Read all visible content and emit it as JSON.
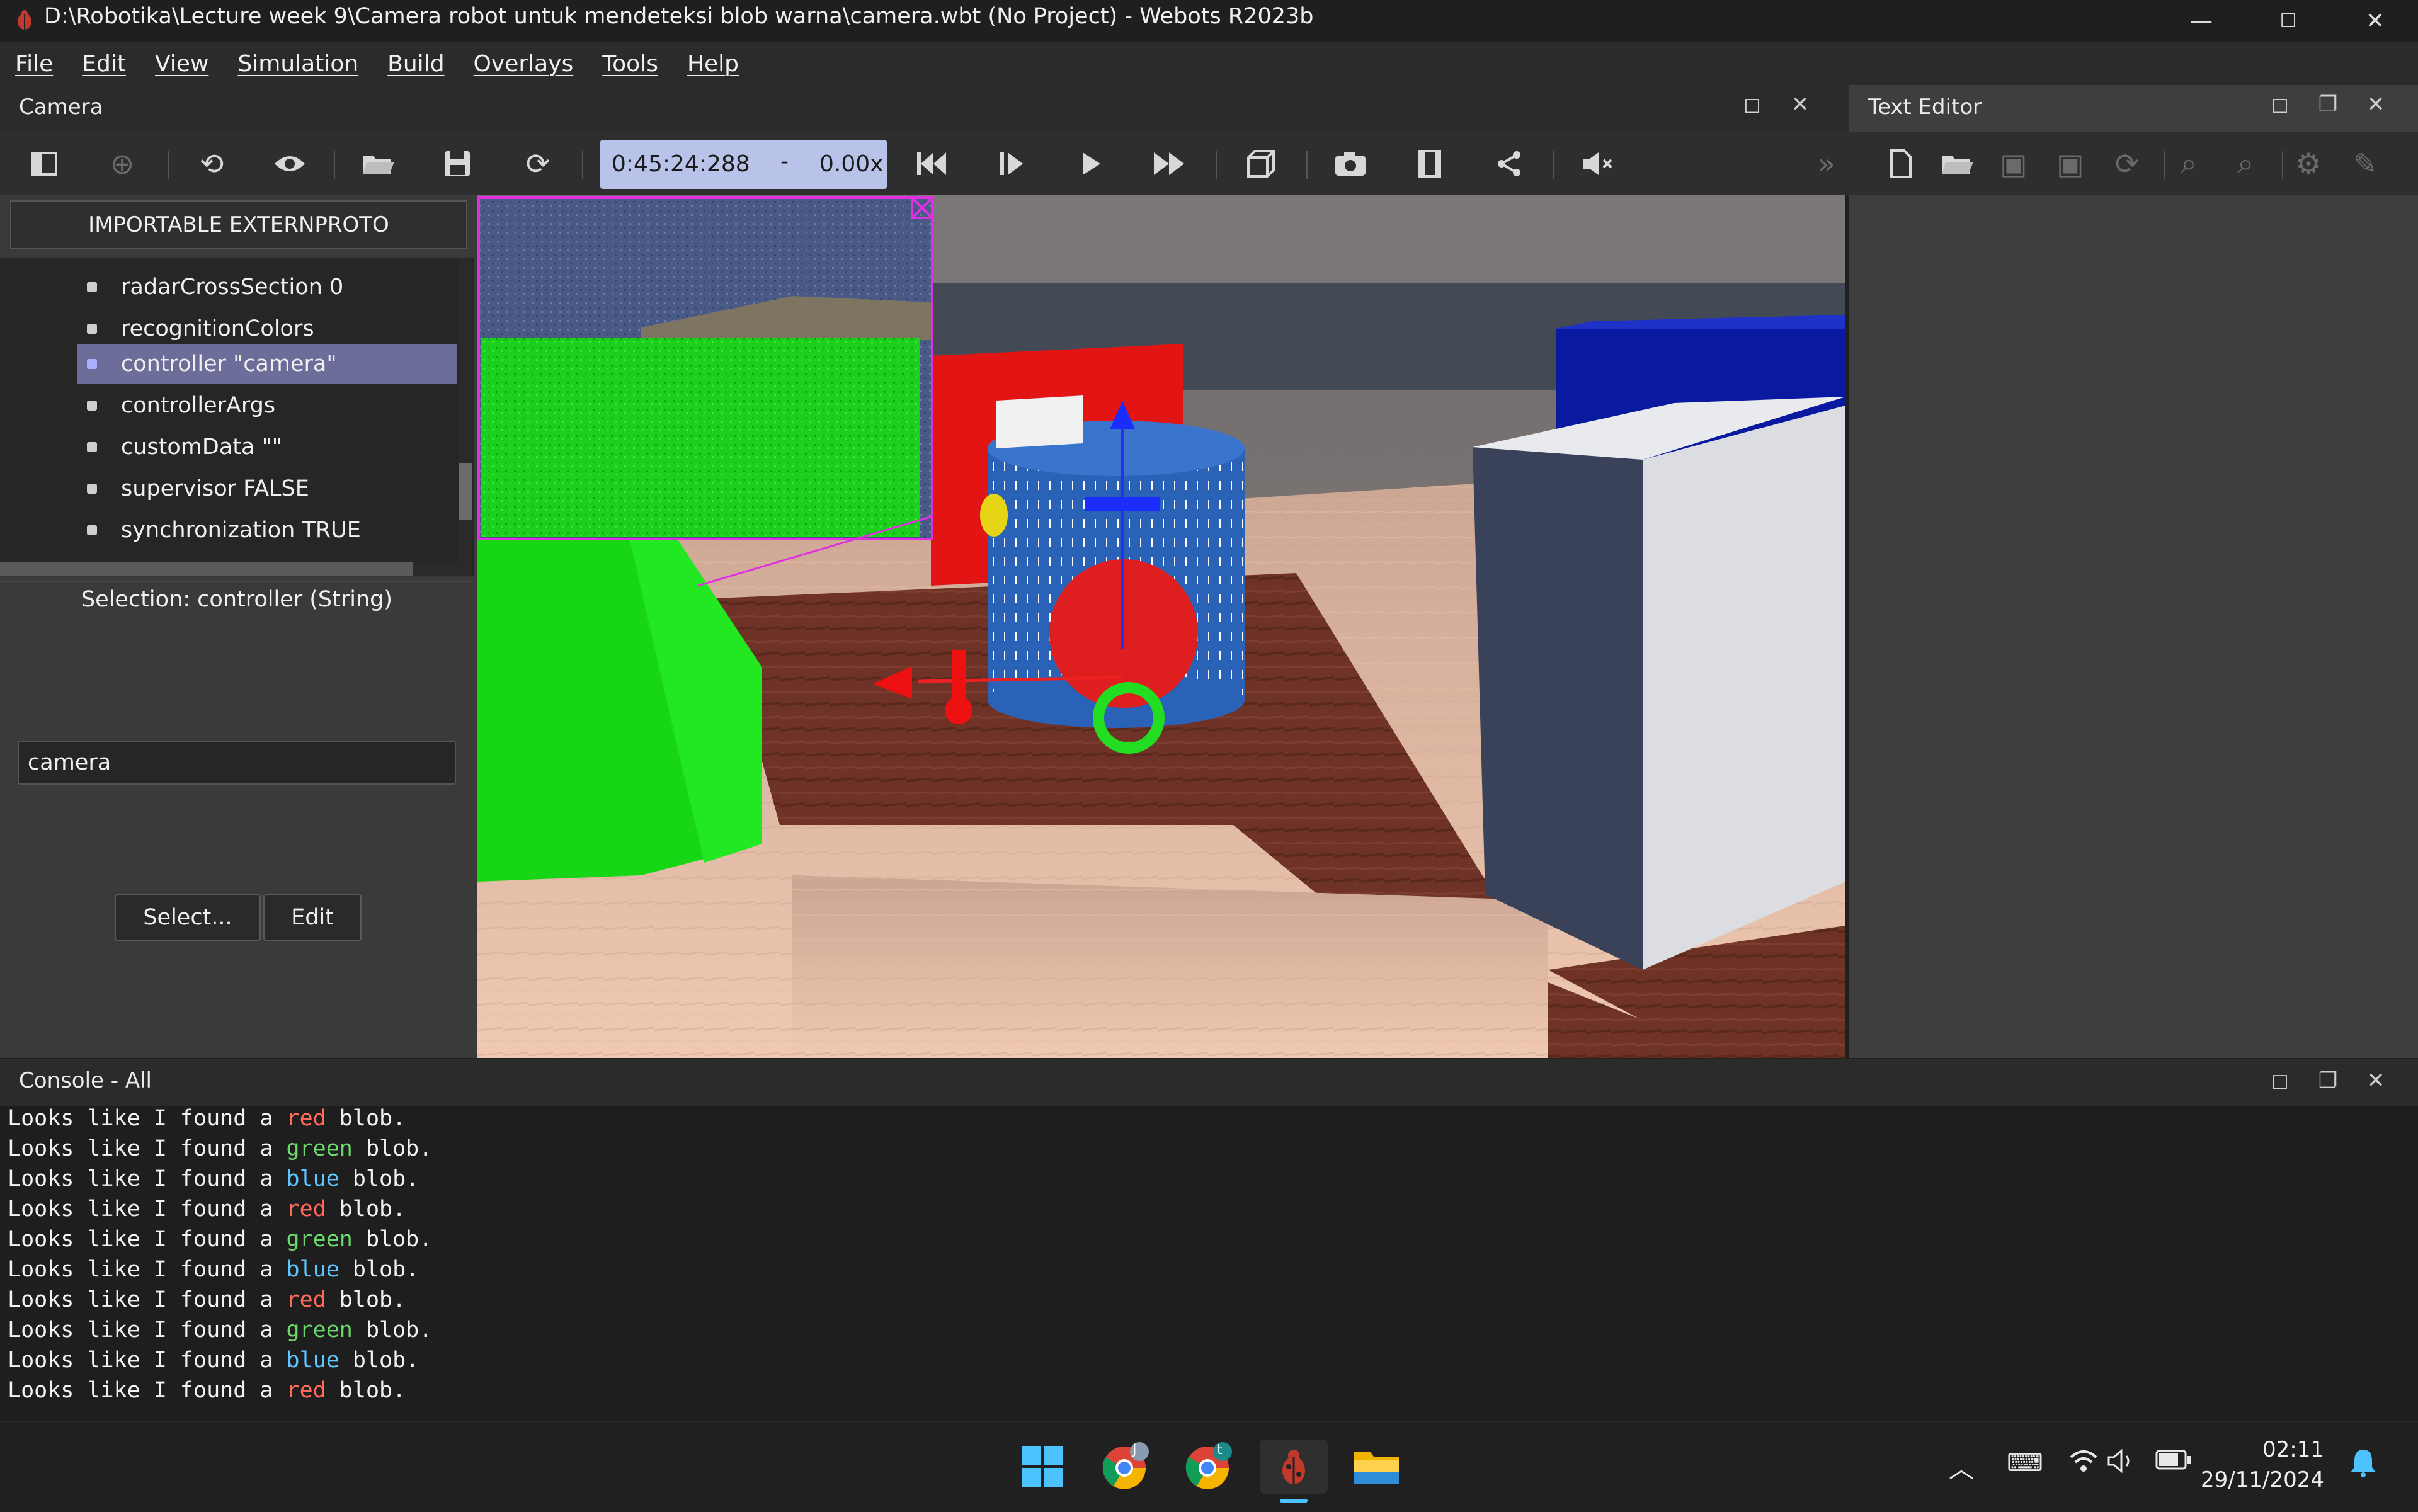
{
  "window": {
    "title": "D:\\Robotika\\Lecture week 9\\Camera robot untuk mendeteksi blob warna\\camera.wbt (No Project) - Webots R2023b",
    "minimize": "—",
    "maximize": "☐",
    "close": "✕"
  },
  "menu": [
    "File",
    "Edit",
    "View",
    "Simulation",
    "Build",
    "Overlays",
    "Tools",
    "Help"
  ],
  "camera_dock": {
    "title": "Camera"
  },
  "toolbar": {
    "time": "0:45:24:288",
    "dash": "-",
    "speed": "0.00x"
  },
  "scene_tree": {
    "importable_button": "IMPORTABLE EXTERNPROTO",
    "items": [
      {
        "label": "radarCrossSection 0",
        "selected": false
      },
      {
        "label": "recognitionColors",
        "selected": false
      },
      {
        "label": "controller \"camera\"",
        "selected": true
      },
      {
        "label": "controllerArgs",
        "selected": false
      },
      {
        "label": "customData \"\"",
        "selected": false
      },
      {
        "label": "supervisor FALSE",
        "selected": false
      },
      {
        "label": "synchronization TRUE",
        "selected": false
      }
    ]
  },
  "field_editor": {
    "selection": "Selection: controller (String)",
    "value": "camera",
    "select_button": "Select...",
    "edit_button": "Edit"
  },
  "text_editor": {
    "title": "Text Editor"
  },
  "console": {
    "title": "Console - All",
    "lines": [
      {
        "pre": "Looks like I found a ",
        "color_word": "red",
        "post": " blob.",
        "color": "red"
      },
      {
        "pre": "Looks like I found a ",
        "color_word": "green",
        "post": " blob.",
        "color": "green"
      },
      {
        "pre": "Looks like I found a ",
        "color_word": "blue",
        "post": " blob.",
        "color": "blue"
      },
      {
        "pre": "Looks like I found a ",
        "color_word": "red",
        "post": " blob.",
        "color": "red"
      },
      {
        "pre": "Looks like I found a ",
        "color_word": "green",
        "post": " blob.",
        "color": "green"
      },
      {
        "pre": "Looks like I found a ",
        "color_word": "blue",
        "post": " blob.",
        "color": "blue"
      },
      {
        "pre": "Looks like I found a ",
        "color_word": "red",
        "post": " blob.",
        "color": "red"
      },
      {
        "pre": "Looks like I found a ",
        "color_word": "green",
        "post": " blob.",
        "color": "green"
      },
      {
        "pre": "Looks like I found a ",
        "color_word": "blue",
        "post": " blob.",
        "color": "blue"
      },
      {
        "pre": "Looks like I found a ",
        "color_word": "red",
        "post": " blob.",
        "color": "red"
      }
    ]
  },
  "taskbar": {
    "time": "02:11",
    "date": "29/11/2024",
    "chrome_badge_1": "J",
    "chrome_badge_2": "t"
  },
  "colors": {
    "selection_highlight": "#6d6d99",
    "time_box": "#b9c3ea",
    "console_red": "#ff6b5b",
    "console_green": "#6bd96b",
    "console_blue": "#5fc7ff"
  }
}
